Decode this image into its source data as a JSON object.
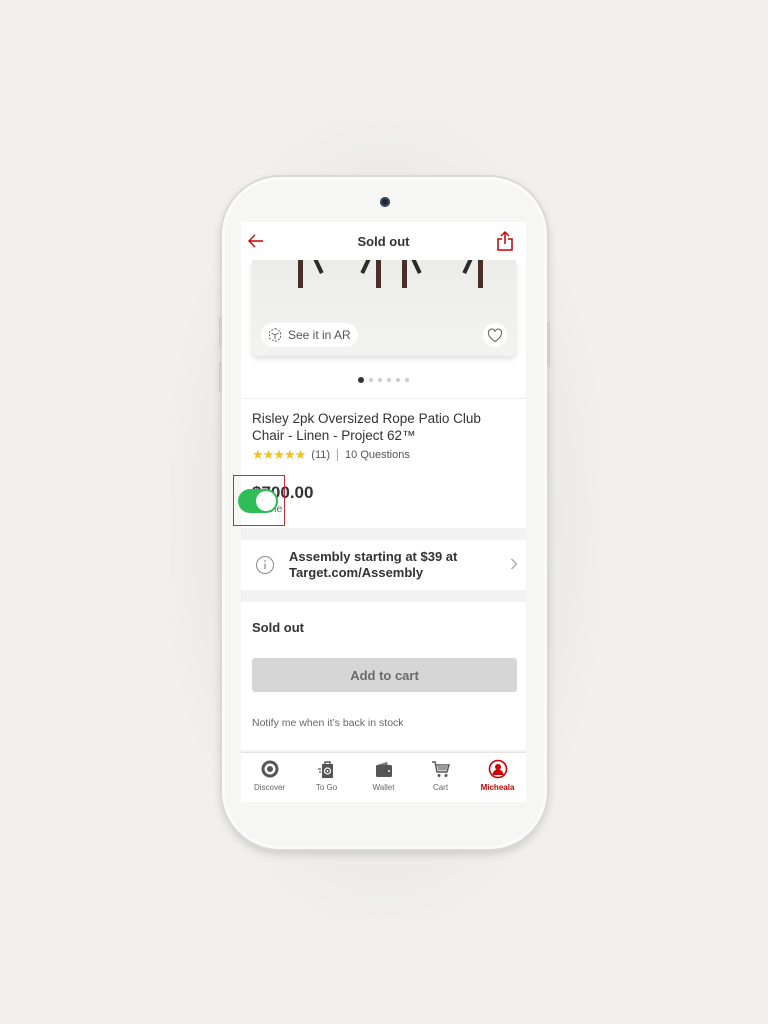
{
  "header": {
    "title": "Sold out",
    "back_icon": "arrow-left-icon",
    "share_icon": "share-icon"
  },
  "gallery": {
    "ar_label": "See it in AR",
    "ar_icon": "ar-cube-icon",
    "favorite_icon": "heart-icon",
    "image_count": 6,
    "active_index": 0
  },
  "product": {
    "title": "Risley 2pk Oversized Rope Patio Club Chair - Linen - Project 62™",
    "rating_stars": "★★★★★",
    "rating_value": 5,
    "review_count": "(11)",
    "questions": "10 Questions",
    "price": "$700.00",
    "price_channel": "Online"
  },
  "assembly": {
    "line1": "Assembly starting at $39 at",
    "line2": "Target.com/Assembly",
    "icon": "info-icon"
  },
  "buybox": {
    "status": "Sold out",
    "add_to_cart_label": "Add to cart",
    "notify_label": "Notify me when it’s back in stock",
    "notify_enabled": true
  },
  "tabbar": {
    "items": [
      {
        "label": "Discover",
        "icon": "target-logo-icon",
        "active": false
      },
      {
        "label": "To Go",
        "icon": "shopping-bag-icon",
        "active": false
      },
      {
        "label": "Wallet",
        "icon": "wallet-icon",
        "active": false
      },
      {
        "label": "Cart",
        "icon": "cart-icon",
        "active": false
      },
      {
        "label": "Micheala",
        "icon": "profile-icon",
        "active": true
      }
    ]
  },
  "colors": {
    "brand_red": "#cc0000",
    "toggle_green": "#2fbd58",
    "star_yellow": "#f6c11a",
    "highlight_red": "#d9262b"
  }
}
